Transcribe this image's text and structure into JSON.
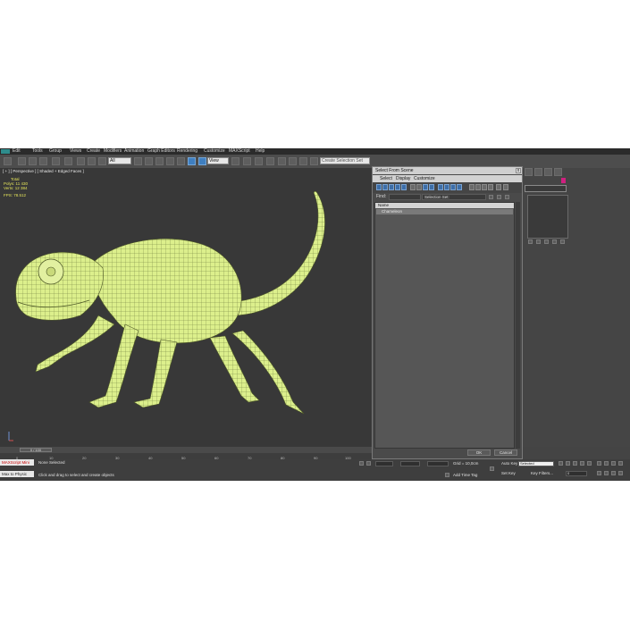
{
  "menubar": {
    "items": [
      "Edit",
      "Tools",
      "Group",
      "Views",
      "Create",
      "Modifiers",
      "Animation",
      "Graph Editors",
      "Rendering",
      "Customize",
      "MAXScript",
      "Help"
    ]
  },
  "toolbar": {
    "filter_dropdown": "All",
    "view_dropdown": "View",
    "selection_set": "Create Selection Set"
  },
  "viewport": {
    "label": "[ + ] [ Perspective ] [ Shaded + Edged Faces ]",
    "stats": {
      "total_label": "Total",
      "polys_label": "Polys:",
      "polys_value": "11 430",
      "verts_label": "Verts:",
      "verts_value": "12 384",
      "fps_label": "FPS:",
      "fps_value": "78.512"
    },
    "model_color": "#dcef8c"
  },
  "dialog": {
    "title": "Select From Scene",
    "close": "x",
    "menu": [
      "Select",
      "Display",
      "Customize"
    ],
    "find_label": "Find:",
    "selection_set_label": "Selection Set:",
    "column_header": "Name",
    "rows": [
      "Chameleon"
    ],
    "ok_label": "OK",
    "cancel_label": "Cancel"
  },
  "timeline": {
    "frame_counter": "0 / 100",
    "ticks": [
      "0",
      "10",
      "20",
      "30",
      "40",
      "50",
      "60",
      "70",
      "80",
      "90",
      "100"
    ]
  },
  "statusbar": {
    "maxscript_line1": "MAXScript Mini",
    "maxscript_line2": "Max to Physic",
    "status": "None Selected",
    "prompt": "Click and drag to select and create objects",
    "grid": "Grid = 10,0cm",
    "add_time_tag": "Add Time Tag",
    "auto_key": "Auto Key",
    "set_key": "Set Key",
    "selected_dropdown": "Selected",
    "key_filters": "Key Filters...",
    "frame_value": "0"
  },
  "colors": {
    "accent": "#3f7fc0",
    "model": "#dcef8c",
    "stats_text": "#e4e45a"
  }
}
